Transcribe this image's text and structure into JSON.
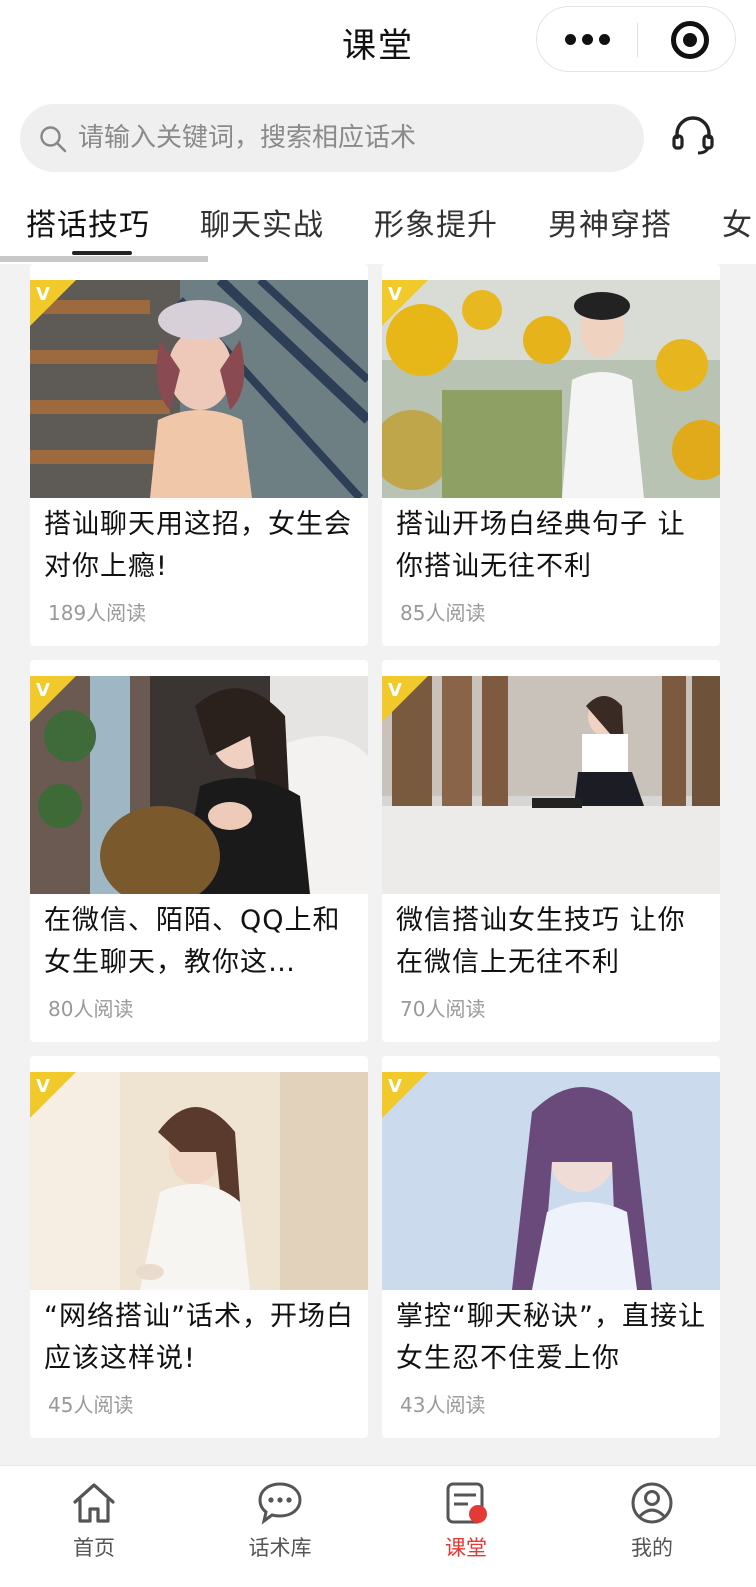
{
  "header": {
    "title": "课堂"
  },
  "search": {
    "placeholder": "请输入关键词，搜索相应话术"
  },
  "tabs": [
    {
      "label": "搭话技巧",
      "active": true
    },
    {
      "label": "聊天实战",
      "active": false
    },
    {
      "label": "形象提升",
      "active": false
    },
    {
      "label": "男神穿搭",
      "active": false
    },
    {
      "label": "女",
      "active": false
    }
  ],
  "cards": [
    {
      "title": "搭讪聊天用这招，女生会对你上瘾!",
      "reads": "189人阅读",
      "badge": "V"
    },
    {
      "title": "搭讪开场白经典句子 让你搭讪无往不利",
      "reads": "85人阅读",
      "badge": "V"
    },
    {
      "title": "在微信、陌陌、QQ上和女生聊天，教你这…",
      "reads": "80人阅读",
      "badge": "V"
    },
    {
      "title": "微信搭讪女生技巧 让你在微信上无往不利",
      "reads": "70人阅读",
      "badge": "V"
    },
    {
      "title": "“网络搭讪”话术，开场白应该这样说!",
      "reads": "45人阅读",
      "badge": "V"
    },
    {
      "title": "掌控“聊天秘诀”，直接让女生忍不住爱上你",
      "reads": "43人阅读",
      "badge": "V"
    }
  ],
  "nav": [
    {
      "label": "首页",
      "icon": "home-icon",
      "active": false
    },
    {
      "label": "话术库",
      "icon": "chat-bubble-icon",
      "active": false
    },
    {
      "label": "课堂",
      "icon": "classroom-icon",
      "active": true
    },
    {
      "label": "我的",
      "icon": "user-icon",
      "active": false
    }
  ],
  "colors": {
    "accent": "#e53935",
    "badge": "#f2c92a",
    "page_bg": "#f2f2f2"
  }
}
